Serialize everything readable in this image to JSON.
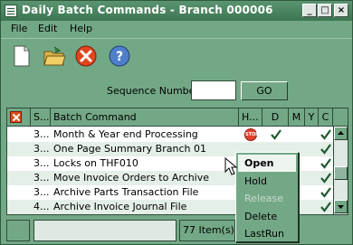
{
  "window": {
    "title": "Daily Batch Commands - Branch 000006",
    "minimize": "_",
    "maximize": "□",
    "close": "×"
  },
  "menu": [
    "File",
    "Edit",
    "Help"
  ],
  "toolbar": {
    "icons": [
      "new-document-icon",
      "open-folder-icon",
      "cancel-icon",
      "help-icon"
    ],
    "help_glyph": "?"
  },
  "sequence": {
    "label": "Sequence Number",
    "value": "",
    "go_label": "GO"
  },
  "grid": {
    "columns": [
      "S...",
      "Batch Command",
      "H...",
      "D",
      "M",
      "Y",
      "C"
    ],
    "rows": [
      {
        "seq": "3...",
        "command": "Month & Year end Processing",
        "hold": true,
        "d": true,
        "m": false,
        "y": false,
        "c": true
      },
      {
        "seq": "3...",
        "command": "One Page Summary Branch 01",
        "hold": false,
        "d": false,
        "m": false,
        "y": false,
        "c": true
      },
      {
        "seq": "3...",
        "command": "Locks on THF010",
        "hold": false,
        "d": false,
        "m": false,
        "y": false,
        "c": true
      },
      {
        "seq": "3...",
        "command": "Move Invoice Orders to Archive",
        "hold": false,
        "d": false,
        "m": false,
        "y": false,
        "c": true
      },
      {
        "seq": "3...",
        "command": "Archive Parts Transaction File",
        "hold": false,
        "d": false,
        "m": false,
        "y": false,
        "c": true
      },
      {
        "seq": "4...",
        "command": "Archive Invoice Journal File",
        "hold": false,
        "d": false,
        "m": false,
        "y": false,
        "c": true
      }
    ],
    "stop_label": "STOP"
  },
  "status": {
    "count_text": "77 Item(s)"
  },
  "context_menu": {
    "items": [
      {
        "label": "Open",
        "state": "selected"
      },
      {
        "label": "Hold",
        "state": "normal"
      },
      {
        "label": "Release",
        "state": "disabled"
      },
      {
        "label": "Delete",
        "state": "normal"
      },
      {
        "label": "LastRun",
        "state": "normal"
      }
    ]
  },
  "colors": {
    "window_bg": "#73a886",
    "titlebar": "#3b7551",
    "check": "#1f5a32",
    "stop": "#e1402c"
  }
}
